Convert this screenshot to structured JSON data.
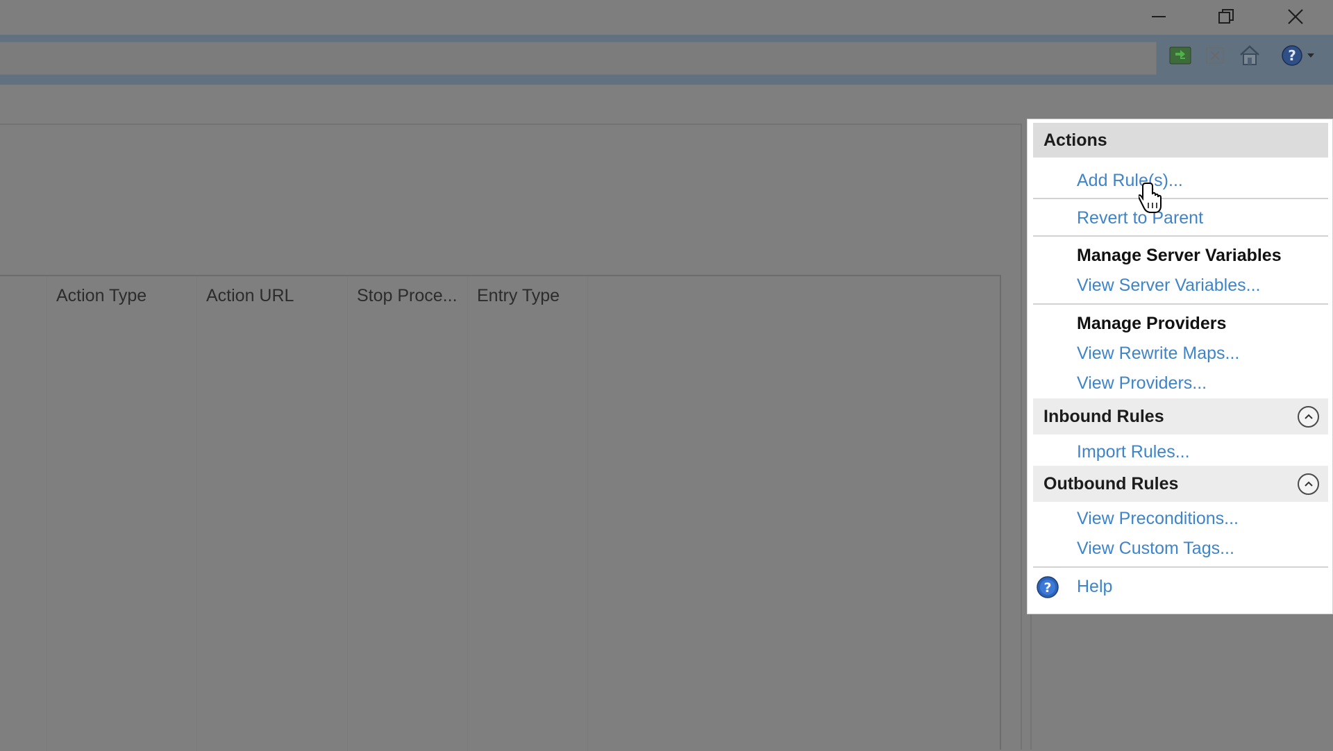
{
  "window": {
    "controls": {
      "minimize_icon": "minimize-icon",
      "restore_icon": "restore-icon",
      "close_icon": "close-icon"
    }
  },
  "toolbar": {
    "icons": [
      "refresh-icon",
      "stop-icon",
      "home-icon",
      "help-icon"
    ]
  },
  "grid": {
    "columns": [
      "Action Type",
      "Action URL",
      "Stop Proce...",
      "Entry Type"
    ]
  },
  "actions": {
    "title": "Actions",
    "add_rules": "Add Rule(s)...",
    "revert_to_parent": "Revert to Parent",
    "manage_server_variables": "Manage Server Variables",
    "view_server_variables": "View Server Variables...",
    "manage_providers": "Manage Providers",
    "view_rewrite_maps": "View Rewrite Maps...",
    "view_providers": "View Providers...",
    "inbound_rules": "Inbound Rules",
    "import_rules": "Import Rules...",
    "outbound_rules": "Outbound Rules",
    "view_preconditions": "View Preconditions...",
    "view_custom_tags": "View Custom Tags...",
    "help": "Help"
  },
  "colors": {
    "link": "#3f84c9",
    "overlay": "#7f7f7f",
    "address_band": "#61717f"
  }
}
